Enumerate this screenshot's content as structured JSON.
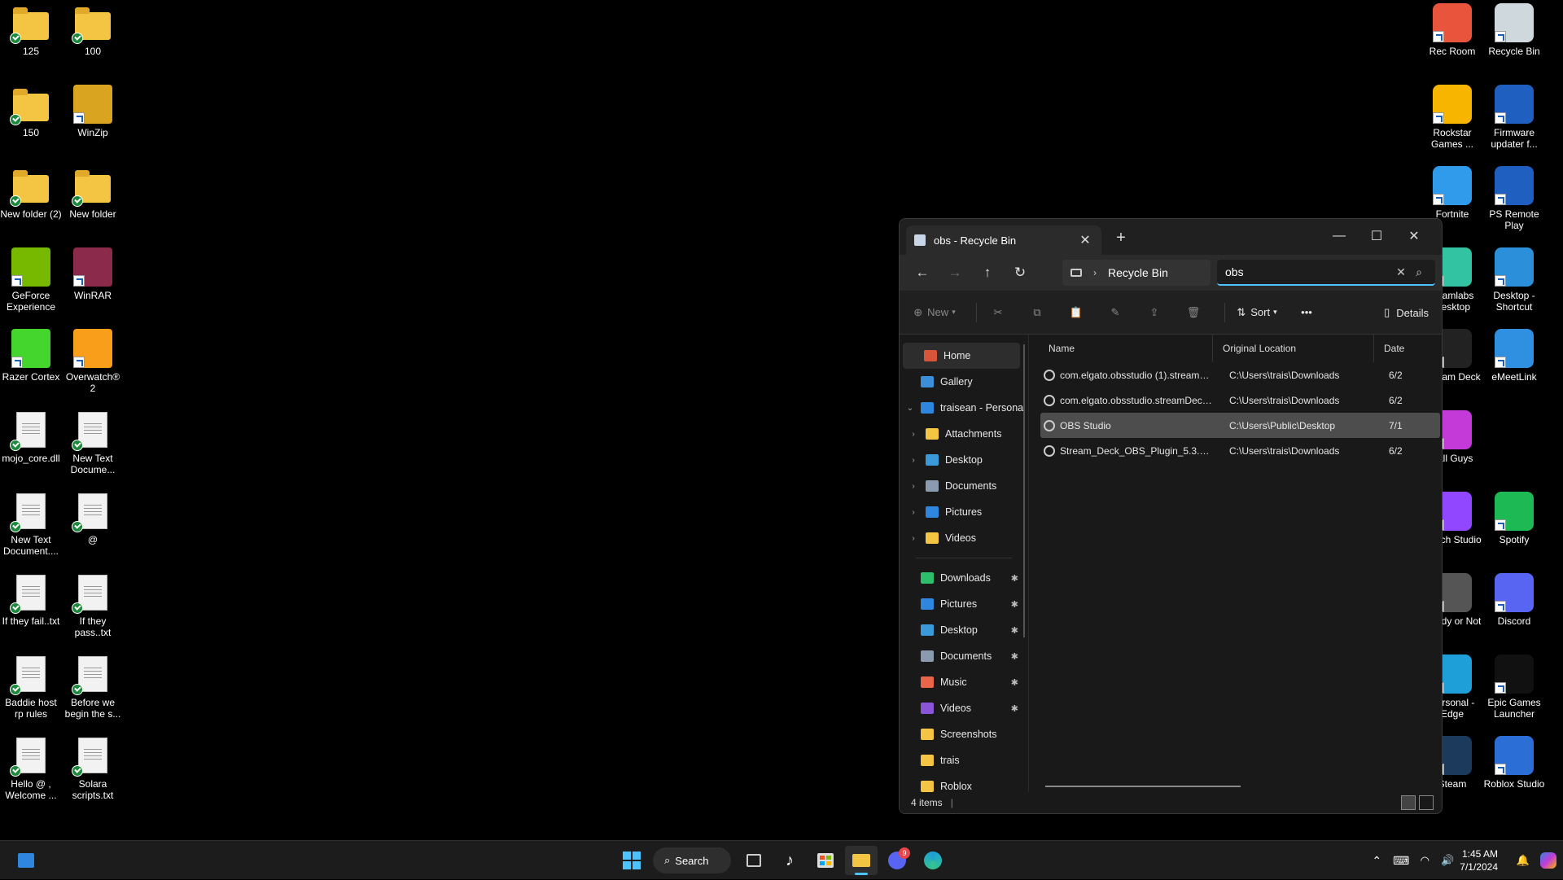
{
  "desktop_left": [
    {
      "label": "125",
      "type": "folder",
      "col": 0,
      "row": 0
    },
    {
      "label": "100",
      "type": "folder",
      "col": 1,
      "row": 0
    },
    {
      "label": "150",
      "type": "folder",
      "col": 0,
      "row": 1
    },
    {
      "label": "WinZip",
      "type": "app",
      "col": 1,
      "row": 1,
      "color": "#d9a521"
    },
    {
      "label": "New folder (2)",
      "type": "folder",
      "col": 0,
      "row": 2
    },
    {
      "label": "New folder",
      "type": "folder",
      "col": 1,
      "row": 2
    },
    {
      "label": "GeForce Experience",
      "type": "app",
      "col": 0,
      "row": 3,
      "color": "#76b900"
    },
    {
      "label": "WinRAR",
      "type": "app",
      "col": 1,
      "row": 3,
      "color": "#8b2a4a"
    },
    {
      "label": "Razer Cortex",
      "type": "app",
      "col": 0,
      "row": 4,
      "color": "#44d62c"
    },
    {
      "label": "Overwatch® 2",
      "type": "app",
      "col": 1,
      "row": 4,
      "color": "#f99e1a"
    },
    {
      "label": "mojo_core.dll",
      "type": "doc",
      "col": 0,
      "row": 5
    },
    {
      "label": "New Text Docume...",
      "type": "doc",
      "col": 1,
      "row": 5
    },
    {
      "label": "New Text Document....",
      "type": "doc",
      "col": 0,
      "row": 6
    },
    {
      "label": "@",
      "type": "doc",
      "col": 1,
      "row": 6
    },
    {
      "label": "If they fail..txt",
      "type": "doc",
      "col": 0,
      "row": 7
    },
    {
      "label": "If they pass..txt",
      "type": "doc",
      "col": 1,
      "row": 7
    },
    {
      "label": "Baddie host rp rules",
      "type": "doc",
      "col": 0,
      "row": 8
    },
    {
      "label": "Before we begin the s...",
      "type": "doc",
      "col": 1,
      "row": 8
    },
    {
      "label": "Hello @ , Welcome ...",
      "type": "doc",
      "col": 0,
      "row": 9
    },
    {
      "label": "Solara scripts.txt",
      "type": "doc",
      "col": 1,
      "row": 9
    }
  ],
  "desktop_right": [
    {
      "label": "Rec Room",
      "col": 0,
      "row": 0,
      "color": "#e8553c"
    },
    {
      "label": "Recycle Bin",
      "col": 1,
      "row": 0,
      "color": "#cfd8dc"
    },
    {
      "label": "Rockstar Games ...",
      "col": 0,
      "row": 1,
      "color": "#f7b500"
    },
    {
      "label": "Firmware updater f...",
      "col": 1,
      "row": 1,
      "color": "#1f5fbf"
    },
    {
      "label": "Fortnite",
      "col": 0,
      "row": 2,
      "color": "#2f9bea"
    },
    {
      "label": "PS Remote Play",
      "col": 1,
      "row": 2,
      "color": "#1f5fbf"
    },
    {
      "label": "treamlabs Desktop",
      "col": 0,
      "row": 3,
      "color": "#31c3a2"
    },
    {
      "label": "Desktop - Shortcut",
      "col": 1,
      "row": 3,
      "color": "#2b90d9"
    },
    {
      "label": "Stream Deck",
      "col": 0,
      "row": 4,
      "color": "#222"
    },
    {
      "label": "eMeetLink",
      "col": 1,
      "row": 4,
      "color": "#2f8fe0"
    },
    {
      "label": "Fall Guys",
      "col": 0,
      "row": 5,
      "color": "#c43ad9"
    },
    {
      "label": "Twitch Studio",
      "col": 0,
      "row": 6,
      "color": "#9146ff"
    },
    {
      "label": "Spotify",
      "col": 1,
      "row": 6,
      "color": "#1db954"
    },
    {
      "label": "Ready or Not",
      "col": 0,
      "row": 7,
      "color": "#555"
    },
    {
      "label": "Discord",
      "col": 1,
      "row": 7,
      "color": "#5865f2"
    },
    {
      "label": "Personal - Edge",
      "col": 0,
      "row": 8,
      "color": "#1e9fd8"
    },
    {
      "label": "Epic Games Launcher",
      "col": 1,
      "row": 8,
      "color": "#111"
    },
    {
      "label": "Steam",
      "col": 0,
      "row": 9,
      "color": "#1b3a5c"
    },
    {
      "label": "Roblox Studio",
      "col": 1,
      "row": 9,
      "color": "#2b6fd6"
    }
  ],
  "window": {
    "tab_title": "obs - Recycle Bin",
    "new_tab": "+",
    "address": "Recycle Bin",
    "search_value": "obs",
    "commands": {
      "new": "New",
      "sort": "Sort",
      "more": "•••",
      "details": "Details"
    },
    "sidebar": [
      {
        "label": "Home",
        "icon": "home-icon",
        "color": "#d8553a",
        "indent": 1,
        "selected": true
      },
      {
        "label": "Gallery",
        "icon": "gallery-icon",
        "color": "#3a8fd8",
        "indent": 1
      },
      {
        "label": "traisean - Persona",
        "icon": "onedrive-icon",
        "color": "#2e86de",
        "indent": 0,
        "expanded": true
      },
      {
        "label": "Attachments",
        "icon": "folder-icon",
        "color": "#f4c542",
        "indent": 2,
        "chev": true
      },
      {
        "label": "Desktop",
        "icon": "desktop-icon",
        "color": "#3a9ad9",
        "indent": 2,
        "chev": true
      },
      {
        "label": "Documents",
        "icon": "documents-icon",
        "color": "#8a9bb0",
        "indent": 2,
        "chev": true
      },
      {
        "label": "Pictures",
        "icon": "pictures-icon",
        "color": "#2e86de",
        "indent": 2,
        "chev": true
      },
      {
        "label": "Videos",
        "icon": "folder-icon",
        "color": "#f4c542",
        "indent": 2,
        "chev": true
      },
      {
        "divider": true
      },
      {
        "label": "Downloads",
        "icon": "download-icon",
        "color": "#2ebd6b",
        "indent": 1,
        "pin": true
      },
      {
        "label": "Pictures",
        "icon": "pictures-icon",
        "color": "#2e86de",
        "indent": 1,
        "pin": true
      },
      {
        "label": "Desktop",
        "icon": "desktop-icon",
        "color": "#3a9ad9",
        "indent": 1,
        "pin": true
      },
      {
        "label": "Documents",
        "icon": "documents-icon",
        "color": "#8a9bb0",
        "indent": 1,
        "pin": true
      },
      {
        "label": "Music",
        "icon": "music-icon",
        "color": "#e8654a",
        "indent": 1,
        "pin": true
      },
      {
        "label": "Videos",
        "icon": "videos-icon",
        "color": "#8a55d8",
        "indent": 1,
        "pin": true
      },
      {
        "label": "Screenshots",
        "icon": "folder-icon",
        "color": "#f4c542",
        "indent": 1
      },
      {
        "label": "trais",
        "icon": "folder-icon",
        "color": "#f4c542",
        "indent": 1
      },
      {
        "label": "Roblox",
        "icon": "folder-icon",
        "color": "#f4c542",
        "indent": 1
      }
    ],
    "columns": {
      "name": "Name",
      "location": "Original Location",
      "date": "Date"
    },
    "files": [
      {
        "name": "com.elgato.obsstudio (1).streamDe...",
        "location": "C:\\Users\\trais\\Downloads",
        "date": "6/2",
        "selected": false
      },
      {
        "name": "com.elgato.obsstudio.streamDeck...",
        "location": "C:\\Users\\trais\\Downloads",
        "date": "6/2",
        "selected": false
      },
      {
        "name": "OBS Studio",
        "location": "C:\\Users\\Public\\Desktop",
        "date": "7/1",
        "selected": true
      },
      {
        "name": "Stream_Deck_OBS_Plugin_5.3.2.35....",
        "location": "C:\\Users\\trais\\Downloads",
        "date": "6/2",
        "selected": false
      }
    ],
    "status": "4 items"
  },
  "taskbar": {
    "search_label": "Search",
    "time": "1:45 AM",
    "date": "7/1/2024",
    "discord_badge": "9"
  }
}
